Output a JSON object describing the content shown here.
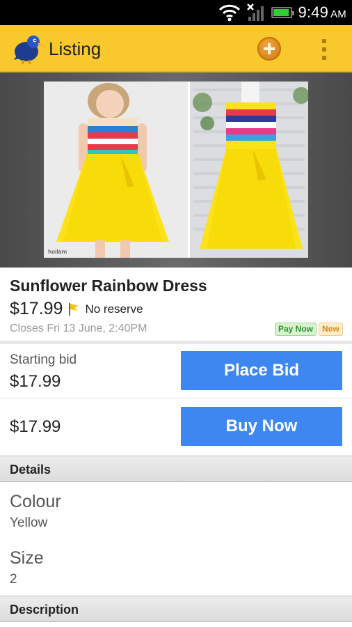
{
  "status_bar": {
    "time": "9:49",
    "ampm": "AM",
    "icons": [
      "wifi-icon",
      "signal-no-service-icon",
      "battery-icon"
    ],
    "battery_level": 0.9,
    "battery_color": "#33cc33"
  },
  "action_bar": {
    "title": "Listing",
    "background_color": "#f8c82c",
    "icons": [
      "kiwi-bird-logo-icon",
      "add-circle-icon",
      "overflow-menu-icon"
    ]
  },
  "listing": {
    "photo_watermark": "hoilam",
    "title": "Sunflower Rainbow Dress",
    "price": "$17.99",
    "reserve": "No reserve",
    "closes": "Closes Fri 13 June, 2:40PM",
    "badges": {
      "pay_now": "Pay Now",
      "new": "New"
    }
  },
  "bid": {
    "starting_label": "Starting bid",
    "starting_value": "$17.99",
    "button_label": "Place Bid"
  },
  "buy": {
    "value": "$17.99",
    "button_label": "Buy Now"
  },
  "button_color": "#3f87f0",
  "details": {
    "header": "Details",
    "items": [
      {
        "label": "Colour",
        "value": "Yellow"
      },
      {
        "label": "Size",
        "value": "2"
      }
    ]
  },
  "description": {
    "header": "Description"
  }
}
